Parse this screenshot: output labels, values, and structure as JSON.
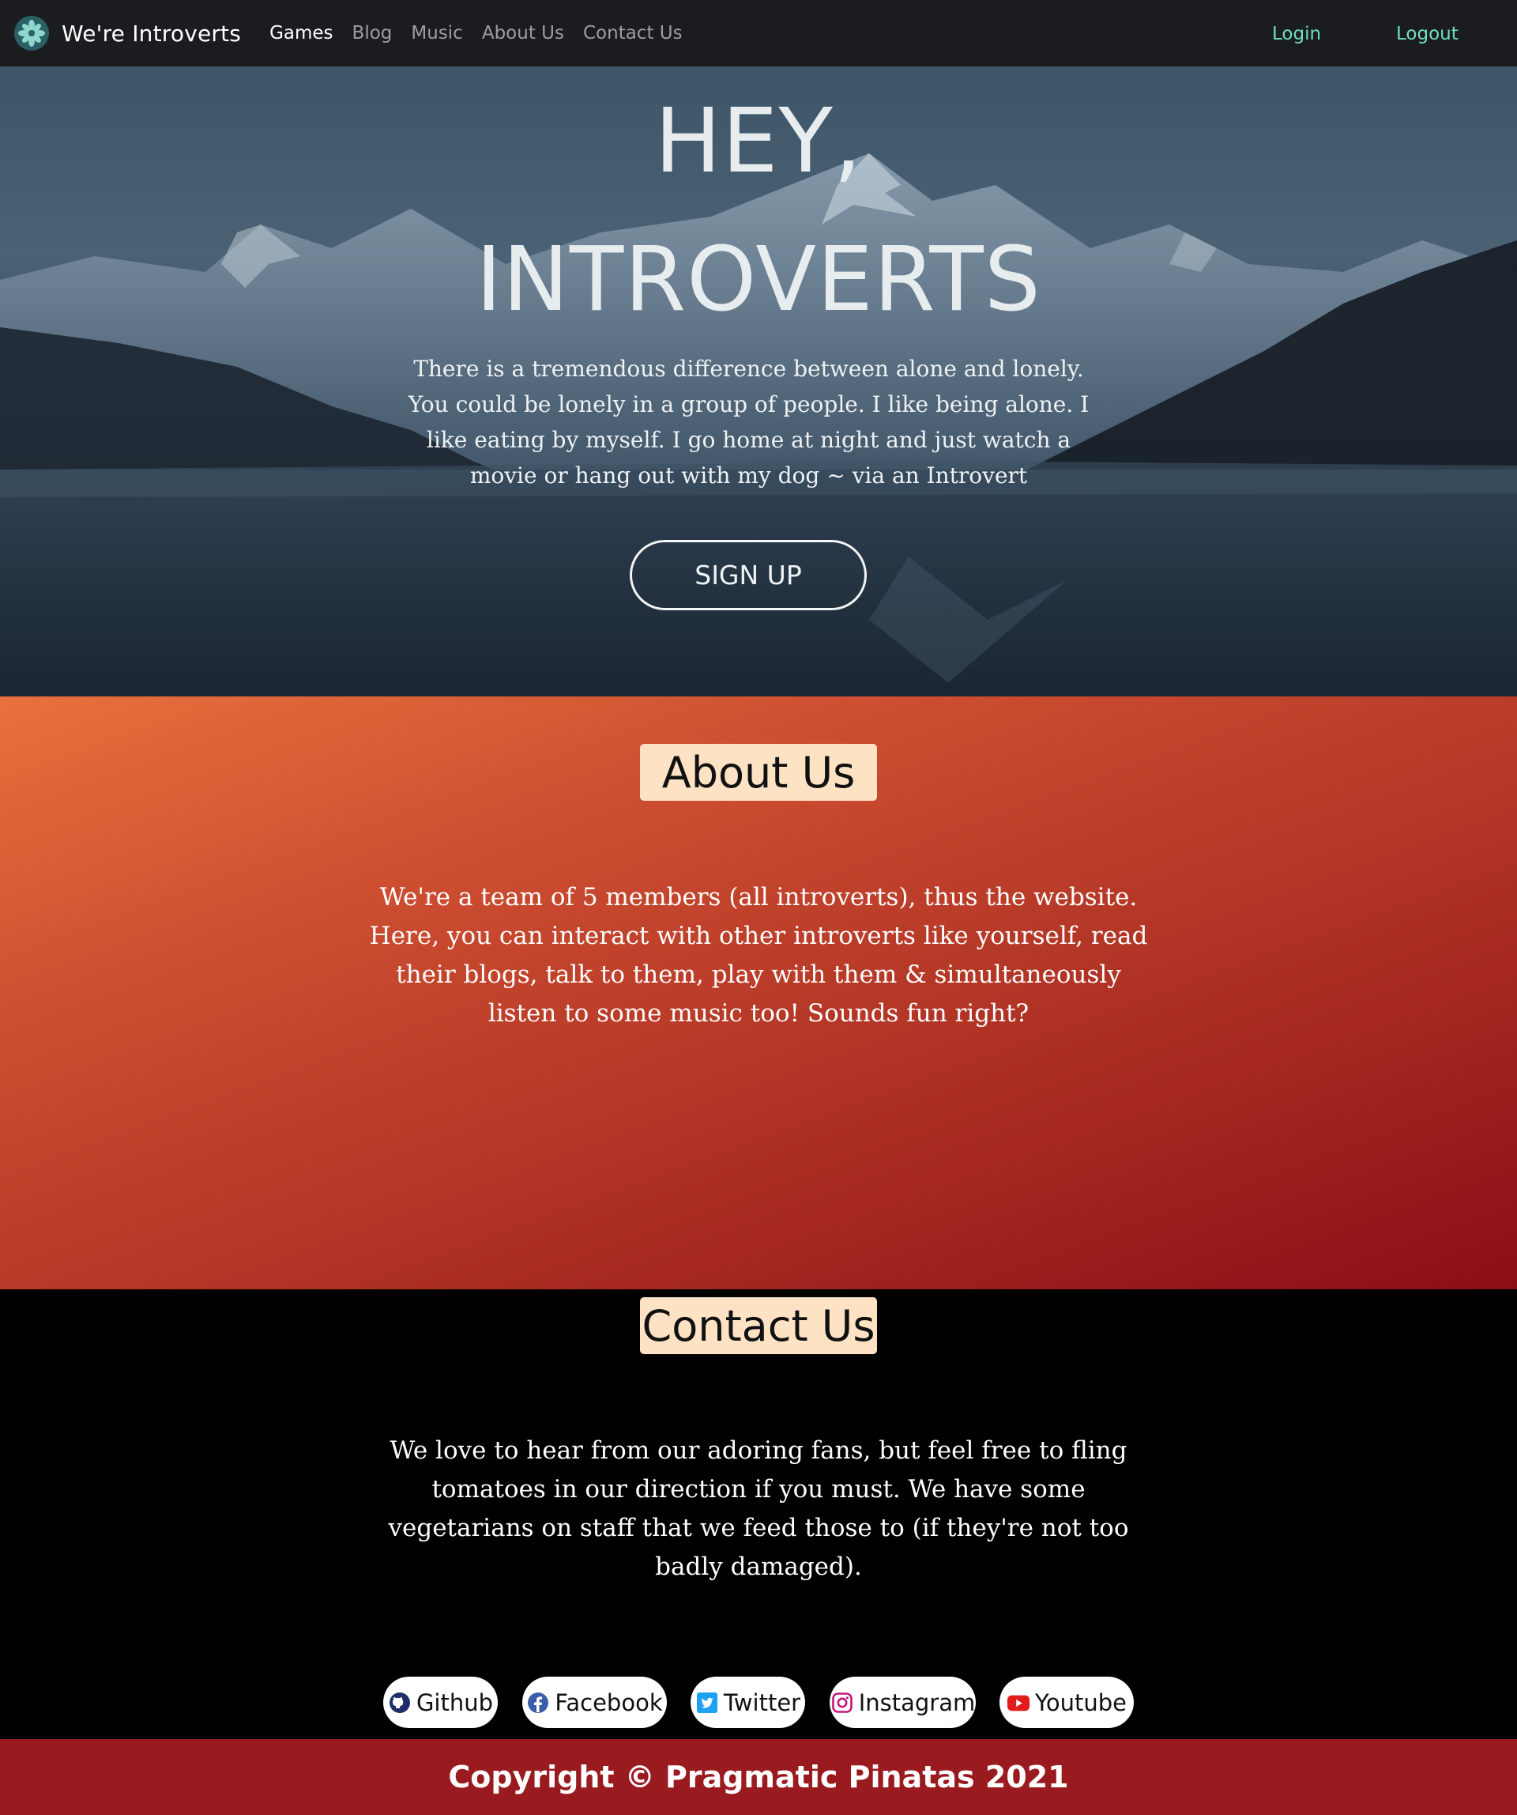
{
  "navbar": {
    "brand": "We're Introverts",
    "links": [
      {
        "label": "Games",
        "active": true
      },
      {
        "label": "Blog",
        "active": false
      },
      {
        "label": "Music",
        "active": false
      },
      {
        "label": "About Us",
        "active": false
      },
      {
        "label": "Contact Us",
        "active": false
      }
    ],
    "login": "Login",
    "logout": "Logout"
  },
  "hero": {
    "title_line1": "HEY,",
    "title_line2": "INTROVERTS",
    "quote": "There is a tremendous difference between alone and lonely. You could be lonely in a group of people. I like being alone. I like eating by myself. I go home at night and just watch a movie or hang out with my dog ~ via an Introvert",
    "signup": "SIGN UP"
  },
  "about": {
    "title": "About Us",
    "text": "We're a team of 5 members (all introverts), thus the website. Here, you can interact with other introverts like yourself, read their blogs, talk to them, play with them & simultaneously listen to some music too! Sounds fun right?"
  },
  "contact": {
    "title": "Contact Us",
    "text": "We love to hear from our adoring fans, but feel free to fling tomatoes in our direction if you must. We have some vegetarians on staff that we feed those to (if they're not too badly damaged).",
    "socials": [
      {
        "label": "Github",
        "icon": "github-icon"
      },
      {
        "label": "Facebook",
        "icon": "facebook-icon"
      },
      {
        "label": "Twitter",
        "icon": "twitter-icon"
      },
      {
        "label": "Instagram",
        "icon": "instagram-icon"
      },
      {
        "label": "Youtube",
        "icon": "youtube-icon"
      }
    ]
  },
  "footer": {
    "copyright": "Copyright © Pragmatic Pinatas 2021"
  },
  "colors": {
    "navbar_bg": "#1b1c1f",
    "auth_link": "#6fe0bd",
    "title_badge_bg": "#fde3c4",
    "footer_bg": "#9a1b1f"
  }
}
